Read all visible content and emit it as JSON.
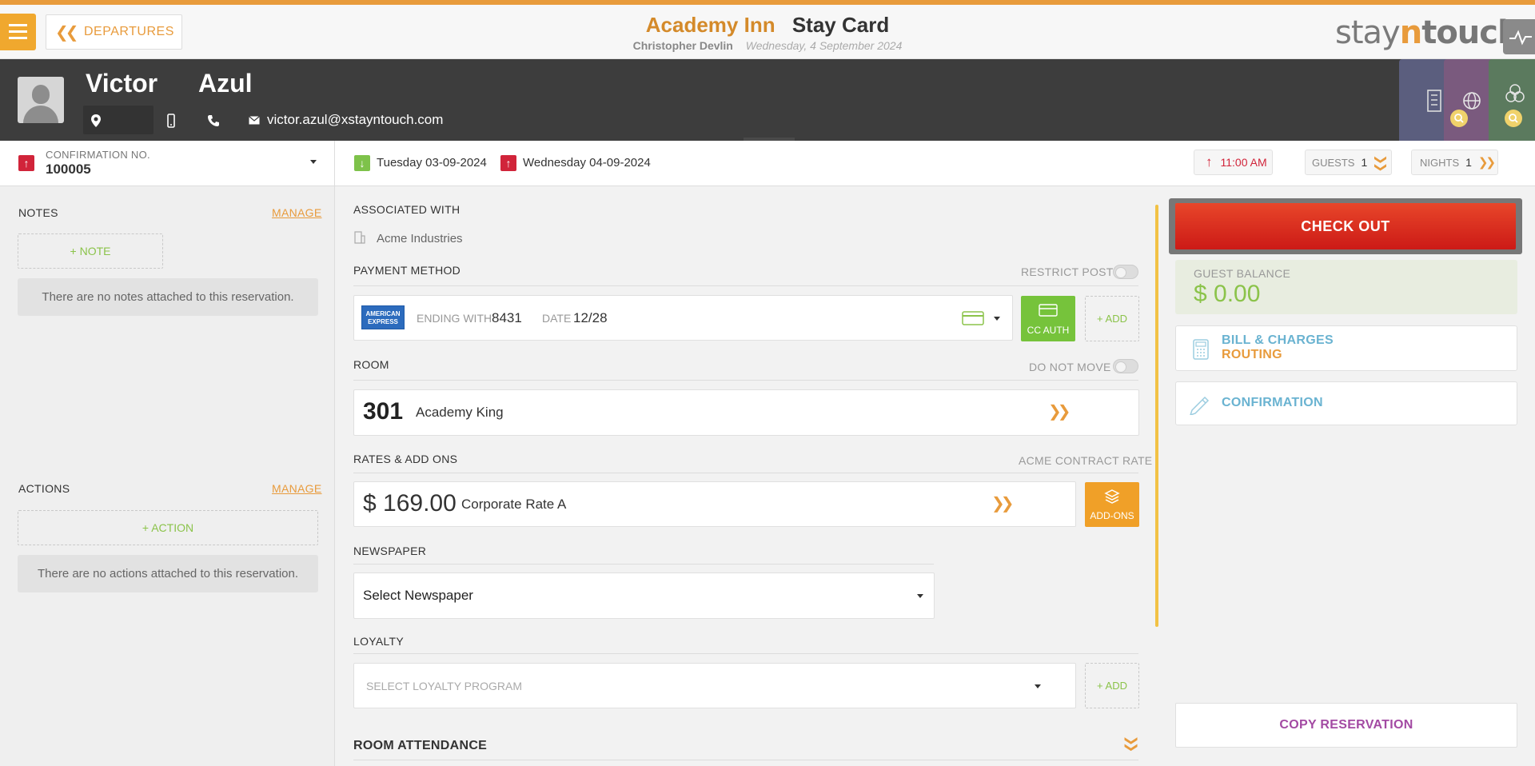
{
  "topbar": {
    "back_label": "DEPARTURES",
    "hotel_name": "Academy Inn",
    "page_title": "Stay Card",
    "user_name": "Christopher Devlin",
    "business_date": "Wednesday, 4 September 2024",
    "logo_prefix": "stay",
    "logo_n": "n",
    "logo_suffix": "touch"
  },
  "guest": {
    "first_name": "Victor",
    "last_name": "Azul",
    "email": "victor.azul@xstayntouch.com"
  },
  "reservation": {
    "confirmation_label": "CONFIRMATION NO.",
    "confirmation_number": "100005",
    "arrival_date": "Tuesday 03-09-2024",
    "departure_date": "Wednesday 04-09-2024",
    "departure_time": "11:00 AM",
    "guests_label": "GUESTS",
    "guests_value": "1",
    "nights_label": "NIGHTS",
    "nights_value": "1"
  },
  "notes": {
    "title": "NOTES",
    "manage": "MANAGE",
    "add_label": "+ NOTE",
    "empty": "There are no notes attached to this reservation."
  },
  "actions": {
    "title": "ACTIONS",
    "manage": "MANAGE",
    "add_label": "+ ACTION",
    "empty": "There are no actions attached to this reservation."
  },
  "associated": {
    "title": "ASSOCIATED WITH",
    "company": "Acme Industries"
  },
  "payment": {
    "title": "PAYMENT METHOD",
    "restrict_label": "RESTRICT POST",
    "card_brand": "AMERICAN EXPRESS",
    "ending_label": "ENDING WITH",
    "ending_value": "8431",
    "date_label": "DATE",
    "date_value": "12/28",
    "cc_auth": "CC AUTH",
    "add": "+ ADD"
  },
  "room": {
    "title": "ROOM",
    "do_not_move": "DO NOT MOVE",
    "number": "301",
    "type": "Academy King"
  },
  "rates": {
    "title": "RATES & ADD ONS",
    "contract": "ACME CONTRACT RATE",
    "amount": "$ 169.00",
    "rate_name": "Corporate Rate A",
    "addons": "ADD-ONS"
  },
  "newspaper": {
    "title": "NEWSPAPER",
    "selected": "Select Newspaper"
  },
  "loyalty": {
    "title": "LOYALTY",
    "placeholder": "SELECT LOYALTY PROGRAM",
    "add": "+ ADD"
  },
  "room_attendance": {
    "title": "ROOM ATTENDANCE"
  },
  "sidebar_right": {
    "checkout": "CHECK OUT",
    "balance_label": "GUEST BALANCE",
    "balance_value": "$ 0.00",
    "bill_line1": "BILL & CHARGES",
    "bill_line2": "ROUTING",
    "confirmation": "CONFIRMATION",
    "copy": "COPY RESERVATION"
  },
  "colors": {
    "accent": "#e89b3c",
    "checkout_red": "#d8231c",
    "positive_green": "#8bc34a",
    "link_blue": "#6ab3d1",
    "copy_purple": "#a34aa3"
  }
}
